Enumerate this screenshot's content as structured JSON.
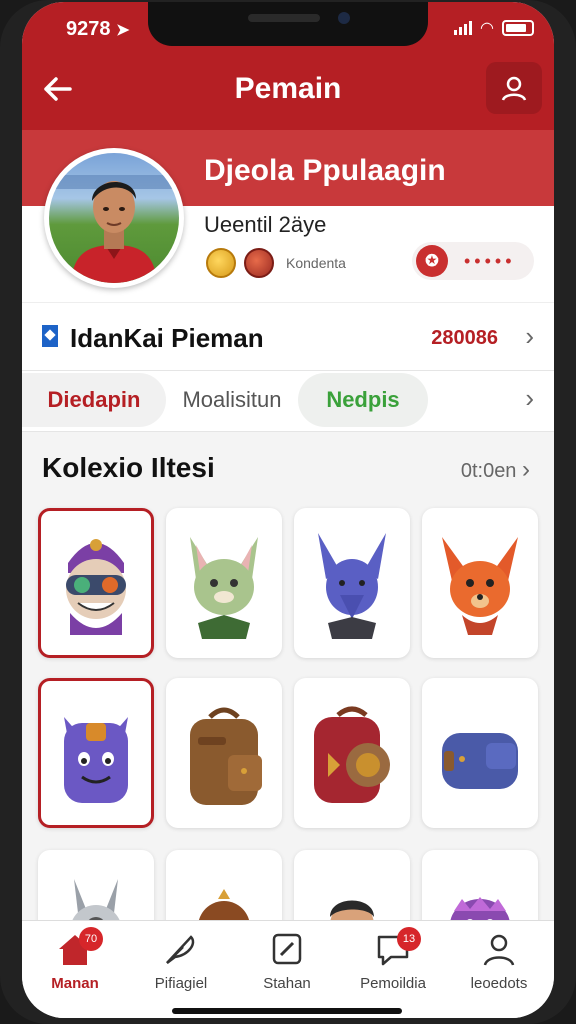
{
  "status_bar": {
    "time": "9278"
  },
  "header": {
    "title": "Pemain"
  },
  "profile": {
    "name": "Djeola Ppulaagin",
    "subtitle": "Ueentil 2äye",
    "badge_label": "Kondenta"
  },
  "rank": {
    "label": "IdanKai Pieman",
    "value": "280086"
  },
  "tabs": [
    {
      "label": "Diedapin",
      "color": "#b51f24"
    },
    {
      "label": "Moalisitun"
    },
    {
      "label": "Nedpis",
      "color": "#3aa13a"
    }
  ],
  "collection": {
    "title": "Kolexio Iltesi",
    "more_label": "0t:0en",
    "items": [
      {
        "name": "purple-goggle-character-icon",
        "selected": true
      },
      {
        "name": "green-cat-icon"
      },
      {
        "name": "blue-fox-icon"
      },
      {
        "name": "orange-fox-icon"
      },
      {
        "name": "purple-monster-backpack-icon",
        "selected": true
      },
      {
        "name": "brown-backpack-icon"
      },
      {
        "name": "red-backpack-icon"
      },
      {
        "name": "blue-backpack-icon"
      },
      {
        "name": "grey-rabbit-icon"
      },
      {
        "name": "brown-hat-icon"
      },
      {
        "name": "boy-character-icon"
      },
      {
        "name": "gold-crown-icon"
      }
    ]
  },
  "bottom_nav": [
    {
      "label": "Manan",
      "icon": "home-icon",
      "badge": "70",
      "active": true
    },
    {
      "label": "Pifiagiel",
      "icon": "feather-icon"
    },
    {
      "label": "Stahan",
      "icon": "square-icon"
    },
    {
      "label": "Pemoildia",
      "icon": "chat-icon",
      "badge": "13"
    },
    {
      "label": "leoedots",
      "icon": "user-icon"
    }
  ],
  "colors": {
    "brand_red": "#b51f24",
    "accent_green": "#3aa13a"
  }
}
